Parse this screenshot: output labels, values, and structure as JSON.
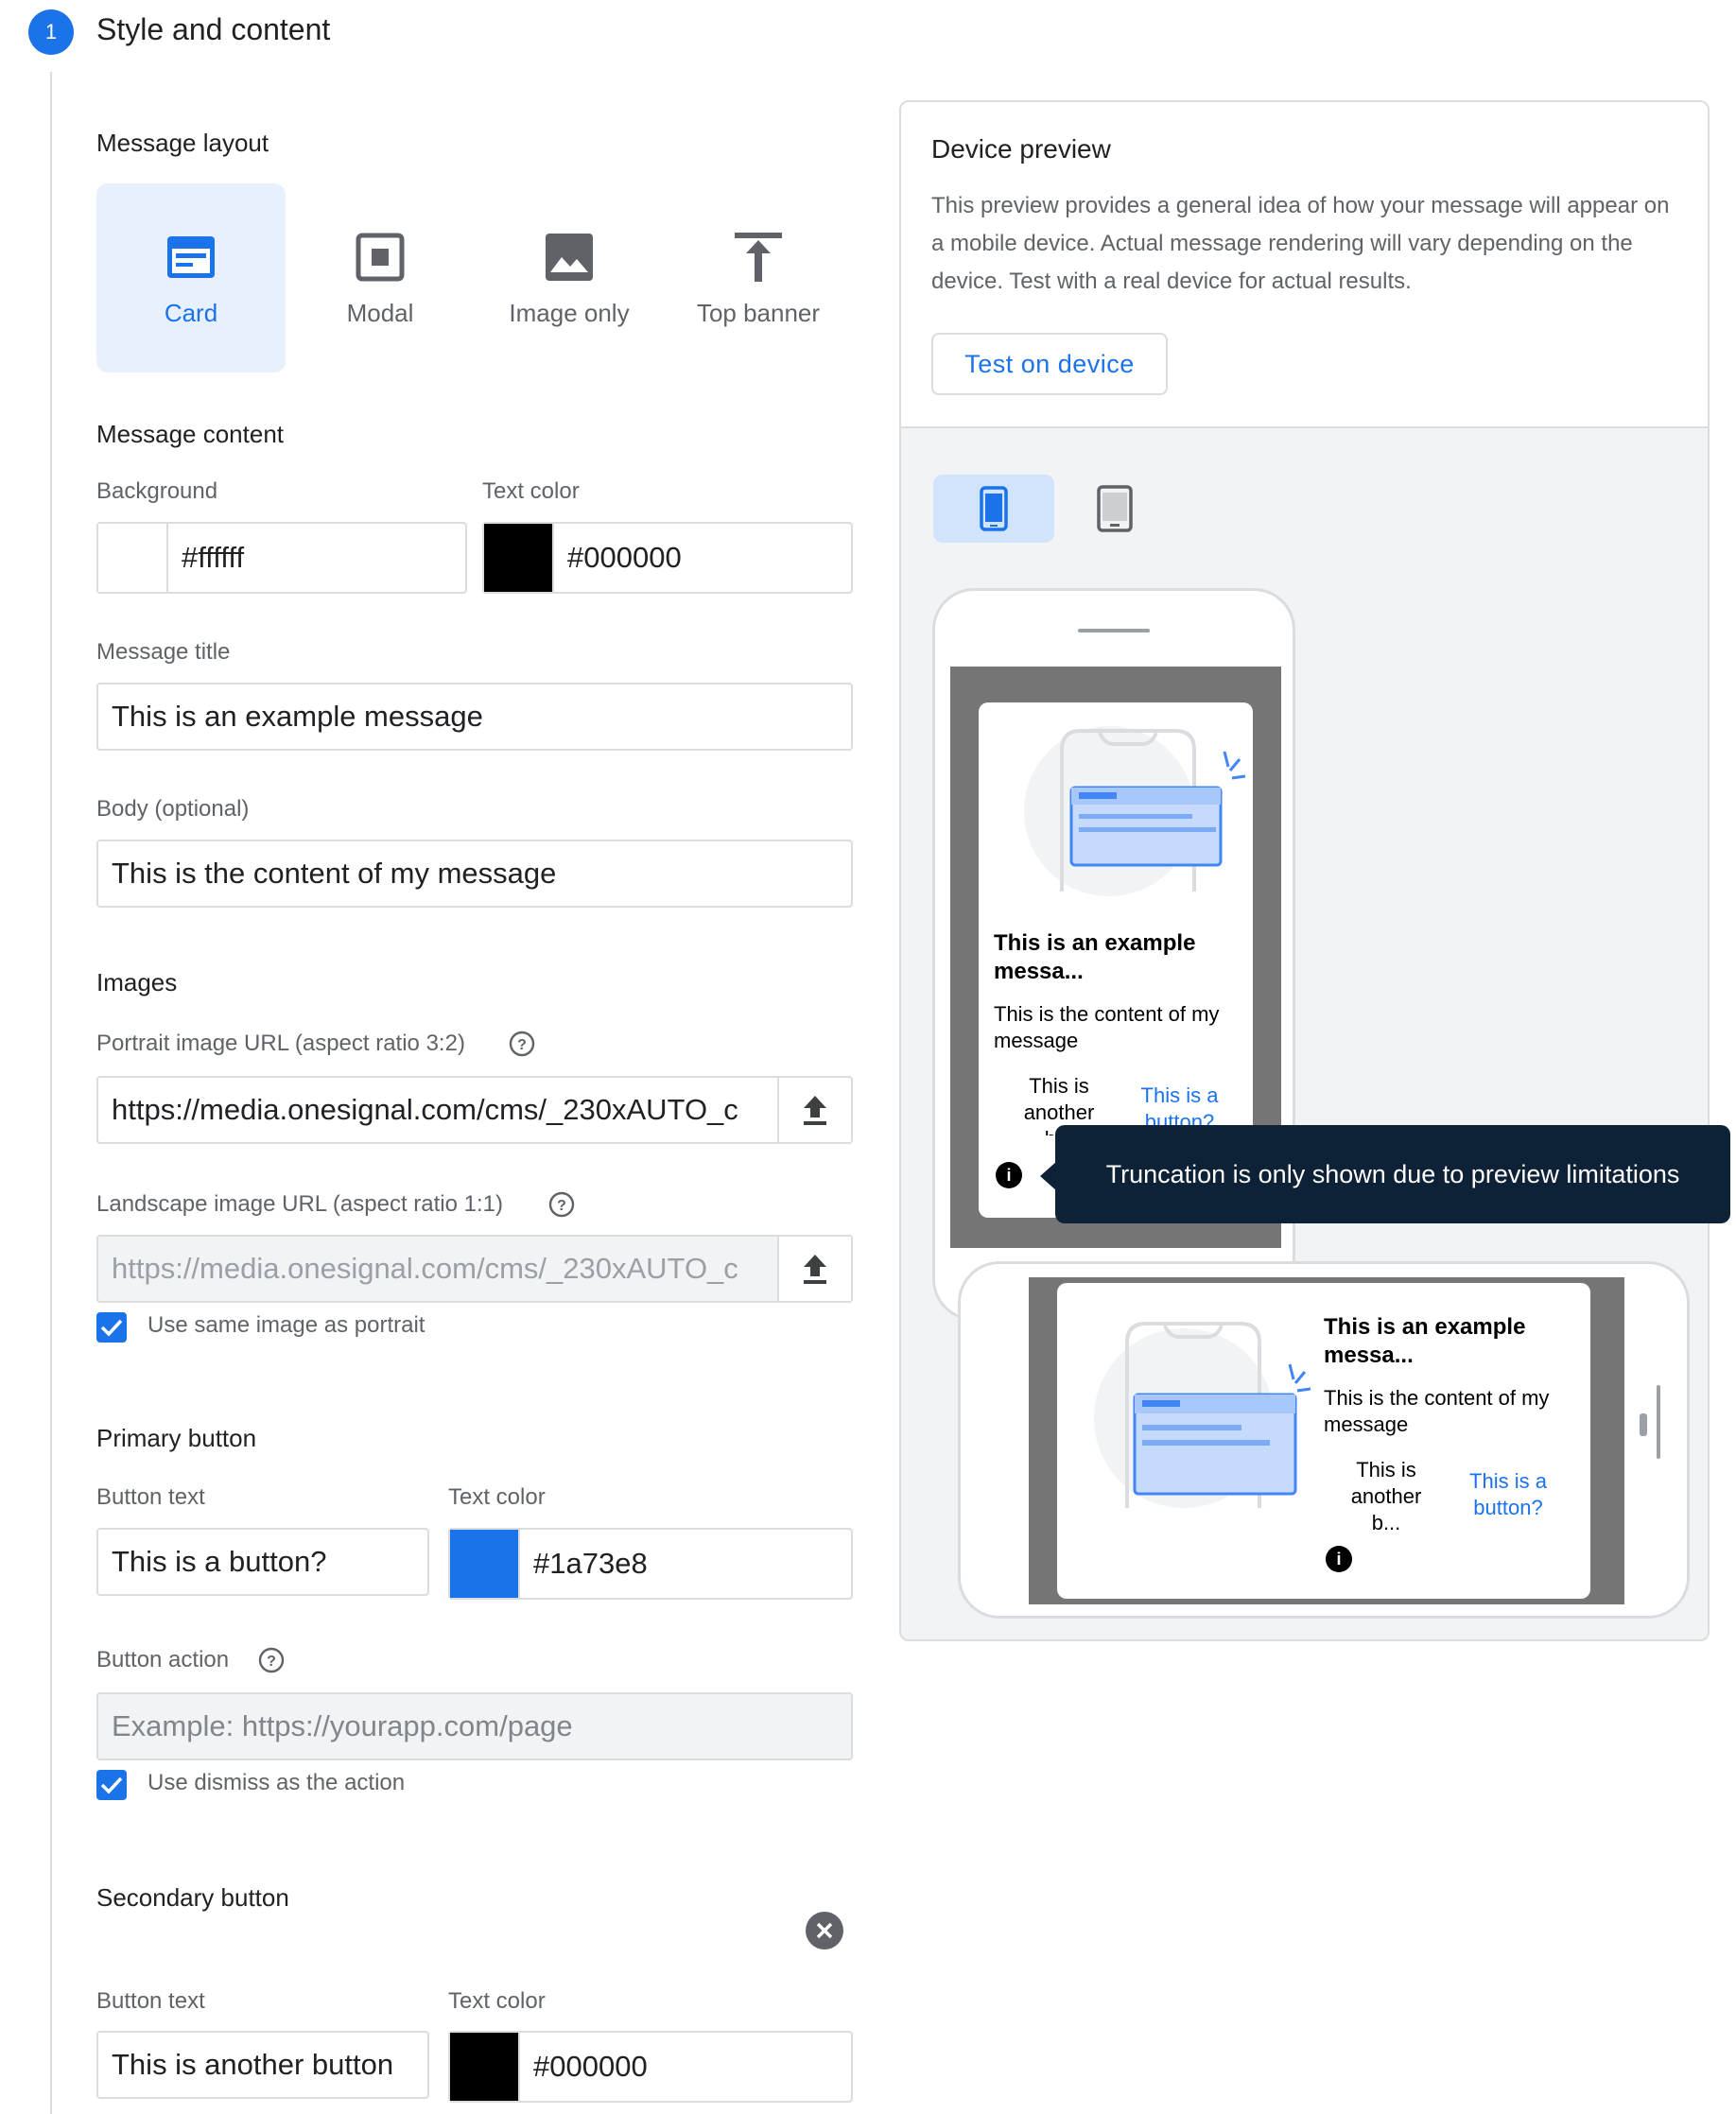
{
  "step": {
    "number": "1",
    "title": "Style and content"
  },
  "layout": {
    "heading": "Message layout",
    "options": [
      {
        "label": "Card",
        "icon": "card-icon",
        "selected": true
      },
      {
        "label": "Modal",
        "icon": "modal-icon",
        "selected": false
      },
      {
        "label": "Image only",
        "icon": "image-icon",
        "selected": false
      },
      {
        "label": "Top banner",
        "icon": "top-banner-icon",
        "selected": false
      }
    ]
  },
  "content": {
    "heading": "Message content",
    "background_label": "Background",
    "background_value": "#ffffff",
    "text_color_label": "Text color",
    "text_color_value": "#000000",
    "title_label": "Message title",
    "title_value": "This is an example message",
    "body_label": "Body (optional)",
    "body_value": "This is the content of my message"
  },
  "images": {
    "heading": "Images",
    "portrait_label": "Portrait image URL (aspect ratio 3:2)",
    "portrait_value": "https://media.onesignal.com/cms/_230xAUTO_c",
    "landscape_label": "Landscape image URL (aspect ratio 1:1)",
    "landscape_value": "https://media.onesignal.com/cms/_230xAUTO_c",
    "same_image_label": "Use same image as portrait"
  },
  "primary": {
    "heading": "Primary button",
    "text_label": "Button text",
    "text_value": "This is a button?",
    "color_label": "Text color",
    "color_value": "#1a73e8",
    "action_label": "Button action",
    "action_placeholder": "Example: https://yourapp.com/page",
    "dismiss_label": "Use dismiss as the action"
  },
  "secondary": {
    "heading": "Secondary button",
    "text_label": "Button text",
    "text_value": "This is another button",
    "color_label": "Text color",
    "color_value": "#000000"
  },
  "preview": {
    "heading": "Device preview",
    "description": "This preview provides a general idea of how your message will appear on a mobile device. Actual message rendering will vary depending on the device. Test with a real device for actual results.",
    "test_button": "Test on device",
    "card_title": "This is an example messa...",
    "card_body": "This is the content of my message",
    "btn_secondary_portrait": "This is another b...",
    "btn_primary_portrait": "This is a button?",
    "btn_secondary_landscape": "This is another b...",
    "btn_primary_landscape": "This is a button?",
    "info_glyph": "i",
    "tooltip": "Truncation is only shown due to preview limitations"
  },
  "colors": {
    "accent": "#1a73e8",
    "tooltip_bg": "#0d2137",
    "screen_bg": "#757575"
  }
}
